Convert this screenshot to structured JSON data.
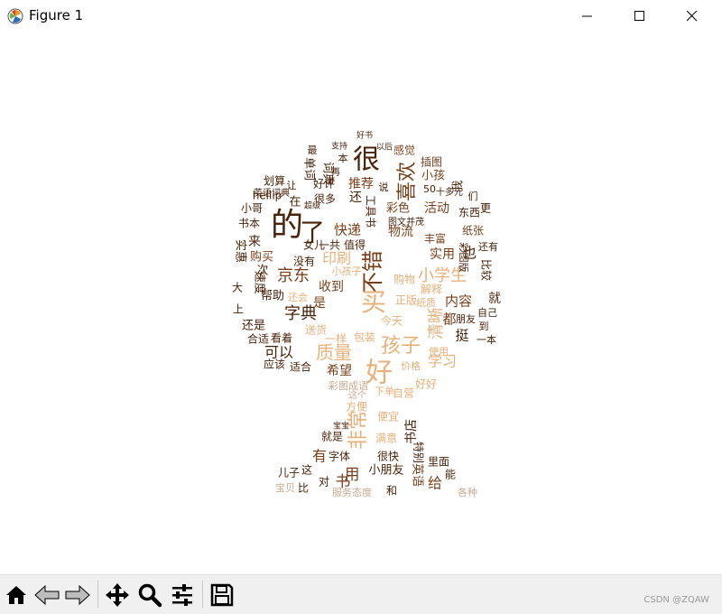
{
  "window": {
    "title": "Figure 1"
  },
  "toolbar": {
    "buttons": [
      {
        "name": "home-button",
        "icon": "home-icon"
      },
      {
        "name": "back-button",
        "icon": "arrow-left-icon"
      },
      {
        "name": "forward-button",
        "icon": "arrow-right-icon"
      },
      {
        "name": "pan-button",
        "icon": "move-icon"
      },
      {
        "name": "zoom-button",
        "icon": "magnifier-icon"
      },
      {
        "name": "configure-button",
        "icon": "sliders-icon"
      },
      {
        "name": "save-button",
        "icon": "floppy-icon"
      }
    ]
  },
  "watermark": "CSDN @ZQAW",
  "colors": {
    "dark": "#4a2208",
    "mid": "#7a3f18",
    "light": "#e8b07a",
    "faint": "#c9aa90"
  },
  "wordcloud": {
    "shape": "tree",
    "words": [
      {
        "t": "的",
        "c": "dark"
      },
      {
        "t": "了",
        "c": "dark"
      },
      {
        "t": "很",
        "c": "dark"
      },
      {
        "t": "不错",
        "c": "mid"
      },
      {
        "t": "买",
        "c": "light"
      },
      {
        "t": "好",
        "c": "light"
      },
      {
        "t": "孩子",
        "c": "light"
      },
      {
        "t": "质量",
        "c": "light"
      },
      {
        "t": "非常",
        "c": "light"
      },
      {
        "t": "喜欢",
        "c": "mid"
      },
      {
        "t": "字典",
        "c": "dark"
      },
      {
        "t": "京东",
        "c": "mid"
      },
      {
        "t": "小学生",
        "c": "light"
      },
      {
        "t": "印刷",
        "c": "light"
      },
      {
        "t": "可以",
        "c": "dark"
      },
      {
        "t": "内容",
        "c": "mid"
      },
      {
        "t": "活动",
        "c": "mid"
      },
      {
        "t": "推荐",
        "c": "mid"
      },
      {
        "t": "学习",
        "c": "light"
      },
      {
        "t": "用",
        "c": "mid"
      },
      {
        "t": "书",
        "c": "mid"
      },
      {
        "t": "给",
        "c": "mid"
      },
      {
        "t": "快递",
        "c": "mid"
      },
      {
        "t": "物流",
        "c": "mid"
      },
      {
        "t": "单词",
        "c": "dark"
      },
      {
        "t": "词典",
        "c": "dark"
      },
      {
        "t": "挺",
        "c": "dark"
      },
      {
        "t": "也",
        "c": "dark"
      },
      {
        "t": "都",
        "c": "mid"
      },
      {
        "t": "就",
        "c": "dark"
      },
      {
        "t": "清晰",
        "c": "light"
      },
      {
        "t": "实用",
        "c": "mid"
      },
      {
        "t": "收到",
        "c": "mid"
      },
      {
        "t": "是",
        "c": "mid"
      },
      {
        "t": "希望",
        "c": "mid"
      },
      {
        "t": "有",
        "c": "mid"
      },
      {
        "t": "购买",
        "c": "mid"
      },
      {
        "t": "速度",
        "c": "dark"
      },
      {
        "t": "还是",
        "c": "dark"
      },
      {
        "t": "帮助",
        "c": "dark"
      },
      {
        "t": "购物",
        "c": "light"
      },
      {
        "t": "正版",
        "c": "light"
      },
      {
        "t": "小孩",
        "c": "mid"
      },
      {
        "t": "插图",
        "c": "mid"
      },
      {
        "t": "感觉",
        "c": "mid"
      },
      {
        "t": "彩色",
        "c": "mid"
      },
      {
        "t": "丰富",
        "c": "mid"
      },
      {
        "t": "纸张",
        "c": "mid"
      },
      {
        "t": "彩图版",
        "c": "dark"
      },
      {
        "t": "比较",
        "c": "dark"
      },
      {
        "t": "朋友",
        "c": "dark"
      },
      {
        "t": "自己",
        "c": "dark"
      },
      {
        "t": "一本",
        "c": "dark"
      },
      {
        "t": "到",
        "c": "dark"
      },
      {
        "t": "还有",
        "c": "dark"
      },
      {
        "t": "东西",
        "c": "dark"
      },
      {
        "t": "更",
        "c": "dark"
      },
      {
        "t": "们",
        "c": "dark"
      },
      {
        "t": "我",
        "c": "dark"
      },
      {
        "t": "十多元",
        "c": "dark"
      },
      {
        "t": "50",
        "c": "dark"
      },
      {
        "t": "说",
        "c": "dark"
      },
      {
        "t": "本",
        "c": "dark"
      },
      {
        "t": "最",
        "c": "dark"
      },
      {
        "t": "再",
        "c": "dark"
      },
      {
        "t": "好评",
        "c": "dark"
      },
      {
        "t": "划算",
        "c": "dark"
      },
      {
        "t": "让",
        "c": "dark"
      },
      {
        "t": "英语词典",
        "c": "dark"
      },
      {
        "t": "在",
        "c": "dark"
      },
      {
        "t": "很多",
        "c": "dark"
      },
      {
        "t": "还",
        "c": "dark"
      },
      {
        "t": "小哥",
        "c": "dark"
      },
      {
        "t": "hellip",
        "c": "dark"
      },
      {
        "t": "书本",
        "c": "dark"
      },
      {
        "t": "来",
        "c": "dark"
      },
      {
        "t": "女儿",
        "c": "dark"
      },
      {
        "t": "一共",
        "c": "dark"
      },
      {
        "t": "值得",
        "c": "dark"
      },
      {
        "t": "没有",
        "c": "dark"
      },
      {
        "t": "实惠",
        "c": "dark"
      },
      {
        "t": "次",
        "c": "dark"
      },
      {
        "t": "大",
        "c": "dark"
      },
      {
        "t": "上",
        "c": "dark"
      },
      {
        "t": "合适",
        "c": "dark"
      },
      {
        "t": "看着",
        "c": "dark"
      },
      {
        "t": "应该",
        "c": "dark"
      },
      {
        "t": "适合",
        "c": "dark"
      },
      {
        "t": "还会",
        "c": "light"
      },
      {
        "t": "送货",
        "c": "light"
      },
      {
        "t": "一样",
        "c": "light"
      },
      {
        "t": "包装",
        "c": "light"
      },
      {
        "t": "今天",
        "c": "light"
      },
      {
        "t": "使用",
        "c": "light"
      },
      {
        "t": "价格",
        "c": "light"
      },
      {
        "t": "好好",
        "c": "light"
      },
      {
        "t": "自营",
        "c": "light"
      },
      {
        "t": "方便",
        "c": "light"
      },
      {
        "t": "下单",
        "c": "light"
      },
      {
        "t": "便宜",
        "c": "light"
      },
      {
        "t": "满意",
        "c": "light"
      },
      {
        "t": "书店",
        "c": "dark"
      },
      {
        "t": "就是",
        "c": "dark"
      },
      {
        "t": "字体",
        "c": "dark"
      },
      {
        "t": "很快",
        "c": "dark"
      },
      {
        "t": "特别",
        "c": "dark"
      },
      {
        "t": "里面",
        "c": "dark"
      },
      {
        "t": "儿子",
        "c": "dark"
      },
      {
        "t": "这",
        "c": "dark"
      },
      {
        "t": "小朋友",
        "c": "dark"
      },
      {
        "t": "英语",
        "c": "mid"
      },
      {
        "t": "能",
        "c": "dark"
      },
      {
        "t": "对",
        "c": "dark"
      },
      {
        "t": "和",
        "c": "dark"
      },
      {
        "t": "宝贝",
        "c": "faint"
      },
      {
        "t": "比",
        "c": "dark"
      },
      {
        "t": "服务态度",
        "c": "faint"
      },
      {
        "t": "各种",
        "c": "faint"
      },
      {
        "t": "彩图成语",
        "c": "faint"
      },
      {
        "t": "这个",
        "c": "faint"
      },
      {
        "t": "小孩子",
        "c": "light"
      },
      {
        "t": "解释",
        "c": "light"
      },
      {
        "t": "纸质",
        "c": "light"
      },
      {
        "t": "宝宝",
        "c": "dark"
      },
      {
        "t": "好书",
        "c": "dark"
      },
      {
        "t": "支持",
        "c": "dark"
      },
      {
        "t": "以后",
        "c": "dark"
      },
      {
        "t": "超级",
        "c": "dark"
      },
      {
        "t": "工具书",
        "c": "dark"
      },
      {
        "t": "图文并茂",
        "c": "dark"
      }
    ]
  }
}
